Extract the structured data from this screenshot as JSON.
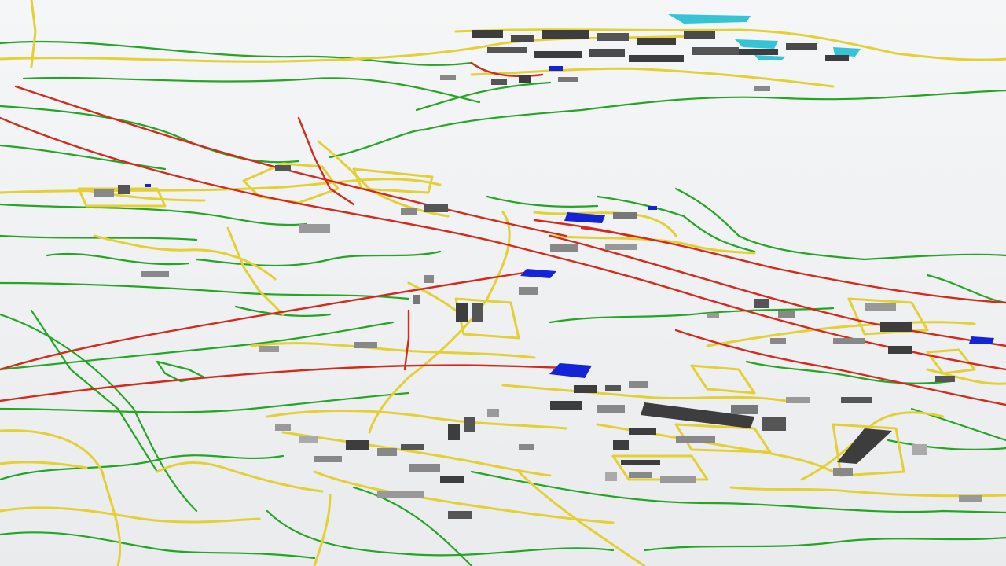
{
  "scene": {
    "type": "3d-perspective-road-network-render",
    "ground_color": "#eef0f2",
    "water_color": "#36c3d6",
    "labels_visible": false
  },
  "legend_colors": {
    "major_road": "#d42a1c",
    "secondary_road": "#e3d034",
    "minor_road": "#24a624",
    "building_dark": "#3d3d3d",
    "building_light": "#9a9a9a",
    "highlighted_building": "#1422d8"
  },
  "road_types": [
    "major-road",
    "secondary-road",
    "minor-road"
  ],
  "feature_types": [
    "building",
    "highlighted-building",
    "water-body"
  ]
}
